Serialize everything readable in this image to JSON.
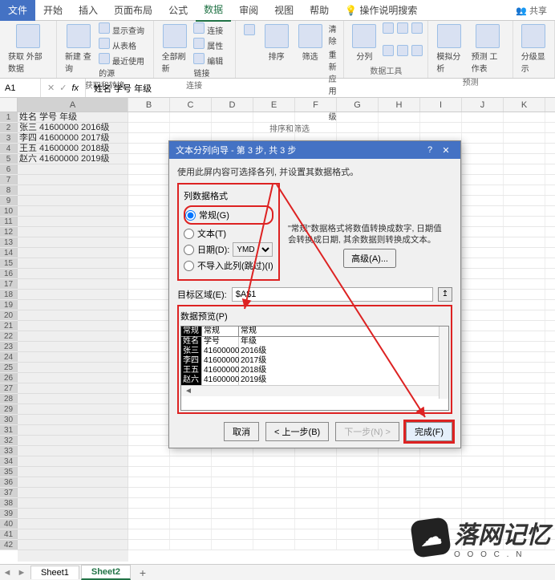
{
  "tabs": {
    "file": "文件",
    "home": "开始",
    "insert": "插入",
    "layout": "页面布局",
    "formulas": "公式",
    "data": "数据",
    "review": "审阅",
    "view": "视图",
    "help": "帮助",
    "search": "操作说明搜索",
    "share": "共享"
  },
  "ribbon": {
    "get_external": "获取\n外部数据",
    "new_query": "新建\n查询",
    "show_query": "显示查询",
    "from_table": "从表格",
    "recent_source": "最近使用的源",
    "group_get": "获取和转换",
    "refresh": "全部刷新",
    "conn": "连接",
    "props": "属性",
    "editlinks": "编辑链接",
    "group_conn": "连接",
    "sort": "排序",
    "filter": "筛选",
    "clear": "清除",
    "reapply": "重新应用",
    "adv": "高级",
    "group_sort": "排序和筛选",
    "text_to_col": "分列",
    "group_tools": "数据工具",
    "whatif": "模拟分析",
    "forecast": "预测\n工作表",
    "group_forecast": "预测",
    "group_outline_btn": "分级显示",
    "group_outline": ""
  },
  "namebox": "A1",
  "formula": "姓名 学号   年级",
  "cols": [
    "A",
    "B",
    "C",
    "D",
    "E",
    "F",
    "G",
    "H",
    "I",
    "J",
    "K"
  ],
  "grid": {
    "r1": "姓名 学号    年级",
    "r2": "张三 41600000  2016级",
    "r3": "李四 41600000  2017级",
    "r4": "王五 41600000  2018级",
    "r5": "赵六 41600000  2019级"
  },
  "dialog": {
    "title": "文本分列向导 - 第 3 步, 共 3 步",
    "desc": "使用此屏内容可选择各列, 并设置其数据格式。",
    "col_format": "列数据格式",
    "opt_general": "常规(G)",
    "opt_text": "文本(T)",
    "opt_date": "日期(D):",
    "date_fmt": "YMD",
    "opt_skip": "不导入此列(跳过)(I)",
    "hint": "\"常规\"数据格式将数值转换成数字, 日期值会转换成日期, 其余数据则转换成文本。",
    "advanced": "高级(A)...",
    "target_label": "目标区域(E):",
    "target_value": "$A$1",
    "preview_label": "数据预览(P)",
    "ph1": "常规",
    "ph2": "常规",
    "ph3": "常规",
    "pv": [
      [
        "姓名",
        "学号",
        "年级"
      ],
      [
        "张三",
        "41600000",
        "2016级"
      ],
      [
        "李四",
        "41600000",
        "2017级"
      ],
      [
        "王五",
        "41600000",
        "2018级"
      ],
      [
        "赵六",
        "41600000",
        "2019级"
      ]
    ],
    "btn_cancel": "取消",
    "btn_back": "< 上一步(B)",
    "btn_next": "下一步(N) >",
    "btn_finish": "完成(F)"
  },
  "sheet_tabs": {
    "s1": "Sheet1",
    "s2": "Sheet2",
    "add": "+"
  },
  "watermark": {
    "text": "落网记忆",
    "sub": "O O O C . N"
  }
}
